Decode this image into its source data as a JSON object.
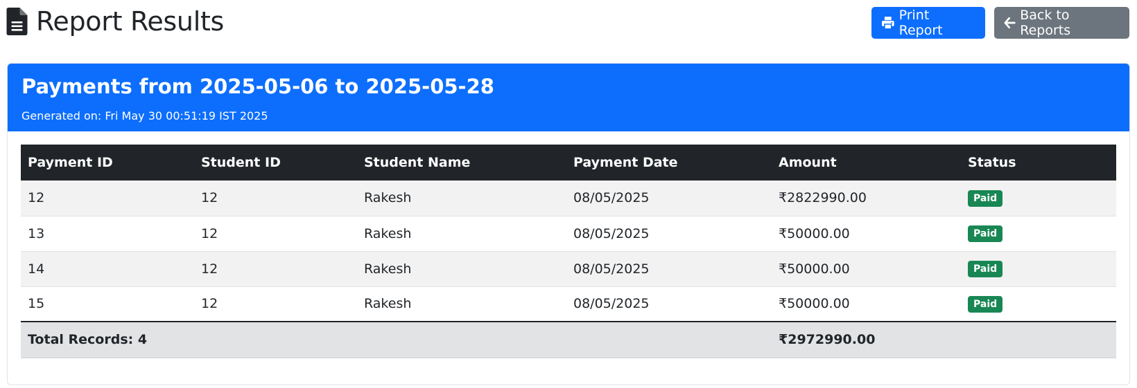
{
  "header": {
    "title": "Report Results",
    "title_icon": "file-text-icon",
    "print_label": "Print Report",
    "print_icon": "printer-icon",
    "back_label": "Back to Reports",
    "back_icon": "arrow-left-icon"
  },
  "report": {
    "title": "Payments from 2025-05-06 to 2025-05-28",
    "generated": "Generated on: Fri May 30 00:51:19 IST 2025"
  },
  "table": {
    "columns": [
      "Payment ID",
      "Student ID",
      "Student Name",
      "Payment Date",
      "Amount",
      "Status"
    ],
    "rows": [
      {
        "payment_id": "12",
        "student_id": "12",
        "student_name": "Rakesh",
        "payment_date": "08/05/2025",
        "amount": "₹2822990.00",
        "status": "Paid"
      },
      {
        "payment_id": "13",
        "student_id": "12",
        "student_name": "Rakesh",
        "payment_date": "08/05/2025",
        "amount": "₹50000.00",
        "status": "Paid"
      },
      {
        "payment_id": "14",
        "student_id": "12",
        "student_name": "Rakesh",
        "payment_date": "08/05/2025",
        "amount": "₹50000.00",
        "status": "Paid"
      },
      {
        "payment_id": "15",
        "student_id": "12",
        "student_name": "Rakesh",
        "payment_date": "08/05/2025",
        "amount": "₹50000.00",
        "status": "Paid"
      }
    ],
    "footer": {
      "total_label": "Total Records: 4",
      "total_amount": "₹2972990.00"
    }
  },
  "colors": {
    "primary": "#0d6efd",
    "secondary": "#6c757d",
    "success": "#198754",
    "dark": "#212529"
  }
}
